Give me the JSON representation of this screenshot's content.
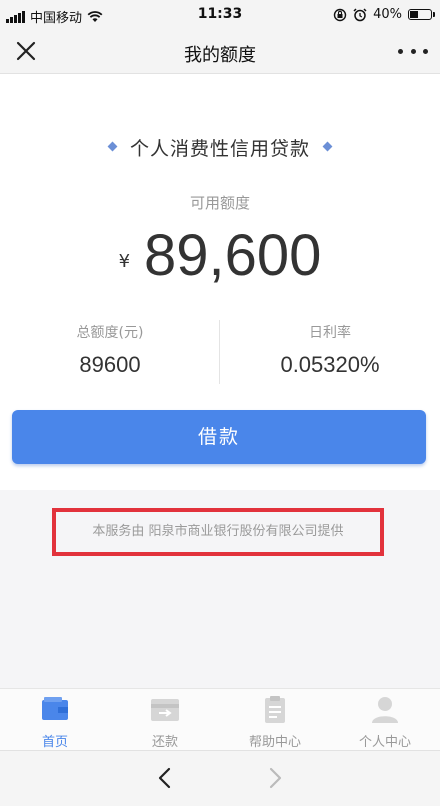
{
  "status_bar": {
    "carrier": "中国移动",
    "time": "11:33",
    "battery": "40%",
    "battery_level": 0.4
  },
  "nav": {
    "title": "我的额度"
  },
  "main": {
    "product_title": "个人消费性信用贷款",
    "available_label": "可用额度",
    "currency_symbol": "¥",
    "available_amount": "89,600",
    "total_label": "总额度(元)",
    "total_value": "89600",
    "rate_label": "日利率",
    "rate_value": "0.05320%",
    "borrow_button": "借款"
  },
  "notice": {
    "text": "本服务由 阳泉市商业银行股份有限公司提供"
  },
  "tab_bar": {
    "tabs": [
      {
        "label": "首页",
        "icon": "wallet-icon",
        "active": true
      },
      {
        "label": "还款",
        "icon": "repay-icon",
        "active": false
      },
      {
        "label": "帮助中心",
        "icon": "clipboard-icon",
        "active": false
      },
      {
        "label": "个人中心",
        "icon": "person-icon",
        "active": false
      }
    ]
  },
  "colors": {
    "accent": "#4a86ea",
    "highlight_border": "#e2323c"
  }
}
